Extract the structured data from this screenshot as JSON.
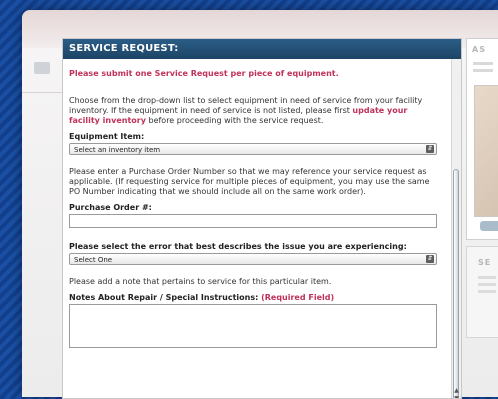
{
  "panel": {
    "title": "SERVICE REQUEST:",
    "notice": "Please submit one Service Request per piece of equipment.",
    "intro_text": "Choose from the drop-down list to select equipment in need of service from your facility inventory. If the equipment in need of service is not listed, please first",
    "intro_link": "update your facility inventory",
    "intro_suffix": "before proceeding with the service request.",
    "equipment": {
      "label": "Equipment Item:",
      "selected": "Select an inventory item"
    },
    "po_text": "Please enter a Purchase Order Number so that we may reference your service request as applicable. (If requesting service for multiple pieces of equipment, you may use the same PO Number indicating that we should include all on the same work order).",
    "po": {
      "label": "Purchase Order #:",
      "value": ""
    },
    "error": {
      "label": "Please select the error that best describes the issue you are experiencing:",
      "selected": "Select One"
    },
    "note_text": "Please add a note that pertains to service for this particular item.",
    "notes": {
      "label": "Notes About Repair / Special Instructions:",
      "required": "(Required Field)",
      "value": ""
    }
  },
  "right": {
    "header1": "AS",
    "header2": "SE"
  },
  "colors": {
    "header_bg": "#1d4466",
    "accent_red": "#c0325a"
  }
}
